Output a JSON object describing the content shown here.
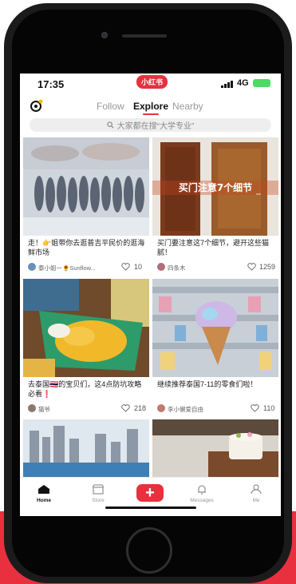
{
  "status": {
    "time": "17:35",
    "brand": "小红书",
    "network": "4G"
  },
  "topnav": {
    "tabs": [
      "Follow",
      "Explore",
      "Nearby"
    ],
    "active": "Explore"
  },
  "search": {
    "placeholder": "大家都在搜“大学专业”"
  },
  "cards": [
    {
      "title": "走！👉姐带你去逛普吉平民价的逛海鲜市场",
      "author": "泰小姐一🌻Sunflow...",
      "likes": "10",
      "image_text": ""
    },
    {
      "title": "买门要注意这7个细节，避开这些猫腻！",
      "author": "四条木",
      "likes": "1259",
      "image_text": "买门注意7个细节"
    },
    {
      "title": "去泰国🇹🇭的宝贝们，这4点防坑攻略必看❗",
      "author": "猫爷",
      "likes": "218",
      "image_text": ""
    },
    {
      "title": "继续推荐泰国7-11的零食们啦！",
      "author": "李小懒爱自由",
      "likes": "110",
      "image_text": ""
    }
  ],
  "bottom_nav": [
    {
      "label": "Home",
      "icon": "home-icon",
      "active": true
    },
    {
      "label": "Store",
      "icon": "store-icon",
      "active": false
    },
    {
      "label": "",
      "icon": "plus-icon",
      "active": false
    },
    {
      "label": "Messages",
      "icon": "bell-icon",
      "active": false
    },
    {
      "label": "Me",
      "icon": "person-icon",
      "active": false
    }
  ],
  "colors": {
    "accent": "#e8303f",
    "battery": "#4cd964"
  }
}
